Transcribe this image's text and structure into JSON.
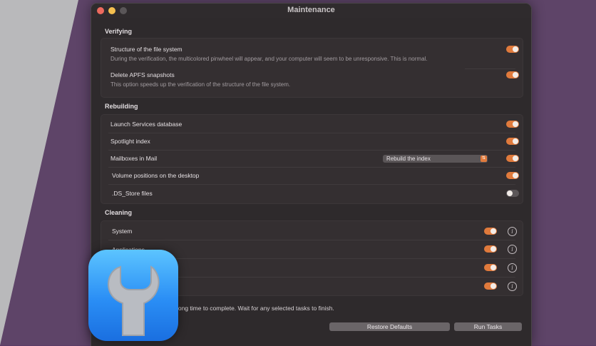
{
  "window": {
    "title": "Maintenance"
  },
  "sections": {
    "verifying": {
      "title": "Verifying",
      "items": [
        {
          "label": "Structure of the file system",
          "description": "During the verification, the multicolored pinwheel will appear, and your computer will seem to be unresponsive. This is normal.",
          "on": true
        },
        {
          "label": "Delete APFS snapshots",
          "description": "This option speeds up the verification of the structure of the file system.",
          "on": true
        }
      ]
    },
    "rebuilding": {
      "title": "Rebuilding",
      "items": [
        {
          "label": "Launch Services database",
          "on": true
        },
        {
          "label": "Spotlight index",
          "on": true
        },
        {
          "label": "Mailboxes in Mail",
          "on": true,
          "select_value": "Rebuild the index"
        },
        {
          "label": "Volume positions on the desktop",
          "on": true
        },
        {
          "label": ".DS_Store files",
          "on": false
        }
      ]
    },
    "cleaning": {
      "title": "Cleaning",
      "items": [
        {
          "label": "System",
          "on": true
        },
        {
          "label": "Applications",
          "on": true
        },
        {
          "label": "",
          "on": true
        },
        {
          "label": "",
          "on": true
        }
      ]
    }
  },
  "footer": {
    "notice": "long time to complete. Wait for any selected tasks to finish.",
    "restore_label": "Restore Defaults",
    "run_label": "Run Tasks"
  },
  "icons": {
    "info": "info-icon",
    "chevron": "chevron-updown-icon",
    "wrench": "wrench-icon"
  },
  "colors": {
    "accent": "#e07a3c",
    "window_bg": "#2e2a2c",
    "icon_blue": "#2a8ef5"
  }
}
